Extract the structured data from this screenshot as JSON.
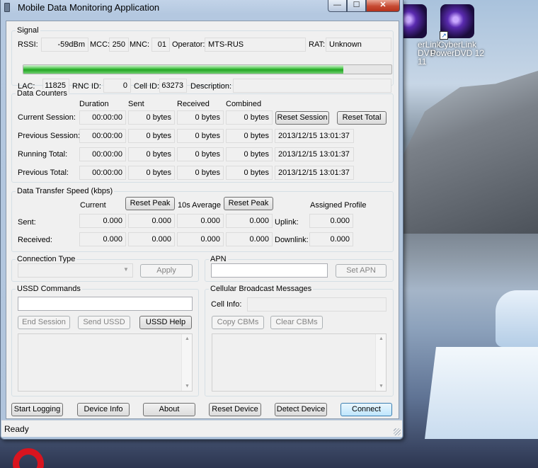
{
  "window": {
    "title": "Mobile Data Monitoring Application"
  },
  "desktop": {
    "icons": [
      {
        "line1": "erLink",
        "line2": "DVD 11"
      },
      {
        "line1": "CyberLink",
        "line2": "PowerDVD 12"
      }
    ]
  },
  "signal": {
    "title": "Signal",
    "rssi_label": "RSSI:",
    "rssi_value": "-59dBm",
    "mcc_label": "MCC:",
    "mcc_value": "250",
    "mnc_label": "MNC:",
    "mnc_value": "01",
    "operator_label": "Operator:",
    "operator_value": "MTS-RUS",
    "rat_label": "RAT:",
    "rat_value": "Unknown",
    "strength_fraction": 0.87,
    "lac_label": "LAC:",
    "lac_value": "11825",
    "rnc_label": "RNC ID:",
    "rnc_value": "0",
    "cell_label": "Cell ID:",
    "cell_value": "63273",
    "desc_label": "Description:",
    "desc_value": ""
  },
  "counters": {
    "title": "Data Counters",
    "headers": [
      "Duration",
      "Sent",
      "Received",
      "Combined"
    ],
    "rows": [
      {
        "label": "Current Session:",
        "duration": "00:00:00",
        "sent": "0 bytes",
        "received": "0 bytes",
        "combined": "0 bytes"
      },
      {
        "label": "Previous Session:",
        "duration": "00:00:00",
        "sent": "0 bytes",
        "received": "0 bytes",
        "combined": "0 bytes",
        "stamp": "2013/12/15 13:01:37"
      },
      {
        "label": "Running Total:",
        "duration": "00:00:00",
        "sent": "0 bytes",
        "received": "0 bytes",
        "combined": "0 bytes",
        "stamp": "2013/12/15 13:01:37"
      },
      {
        "label": "Previous Total:",
        "duration": "00:00:00",
        "sent": "0 bytes",
        "received": "0 bytes",
        "combined": "0 bytes",
        "stamp": "2013/12/15 13:01:37"
      }
    ],
    "reset_session": "Reset Session",
    "reset_total": "Reset Total"
  },
  "speed": {
    "title": "Data Transfer Speed (kbps)",
    "current_label": "Current",
    "reset_peak": "Reset Peak",
    "avg_label": "10s Average",
    "profile_label": "Assigned Profile",
    "sent_label": "Sent:",
    "received_label": "Received:",
    "uplink_label": "Uplink:",
    "downlink_label": "Downlink:",
    "sent_values": [
      "0.000",
      "0.000",
      "0.000",
      "0.000"
    ],
    "received_values": [
      "0.000",
      "0.000",
      "0.000",
      "0.000"
    ],
    "uplink": "0.000",
    "downlink": "0.000"
  },
  "connection": {
    "title": "Connection Type",
    "apply": "Apply"
  },
  "apn": {
    "title": "APN",
    "value": "",
    "set_apn": "Set APN"
  },
  "ussd": {
    "title": "USSD Commands",
    "end_session": "End Session",
    "send_ussd": "Send USSD",
    "help": "USSD Help"
  },
  "cbm": {
    "title": "Cellular Broadcast Messages",
    "cell_info_label": "Cell Info:",
    "copy": "Copy CBMs",
    "clear": "Clear CBMs"
  },
  "bottom": {
    "start_logging": "Start Logging",
    "device_info": "Device Info",
    "about": "About",
    "reset_device": "Reset Device",
    "detect_device": "Detect Device",
    "connect": "Connect"
  },
  "status": "Ready"
}
